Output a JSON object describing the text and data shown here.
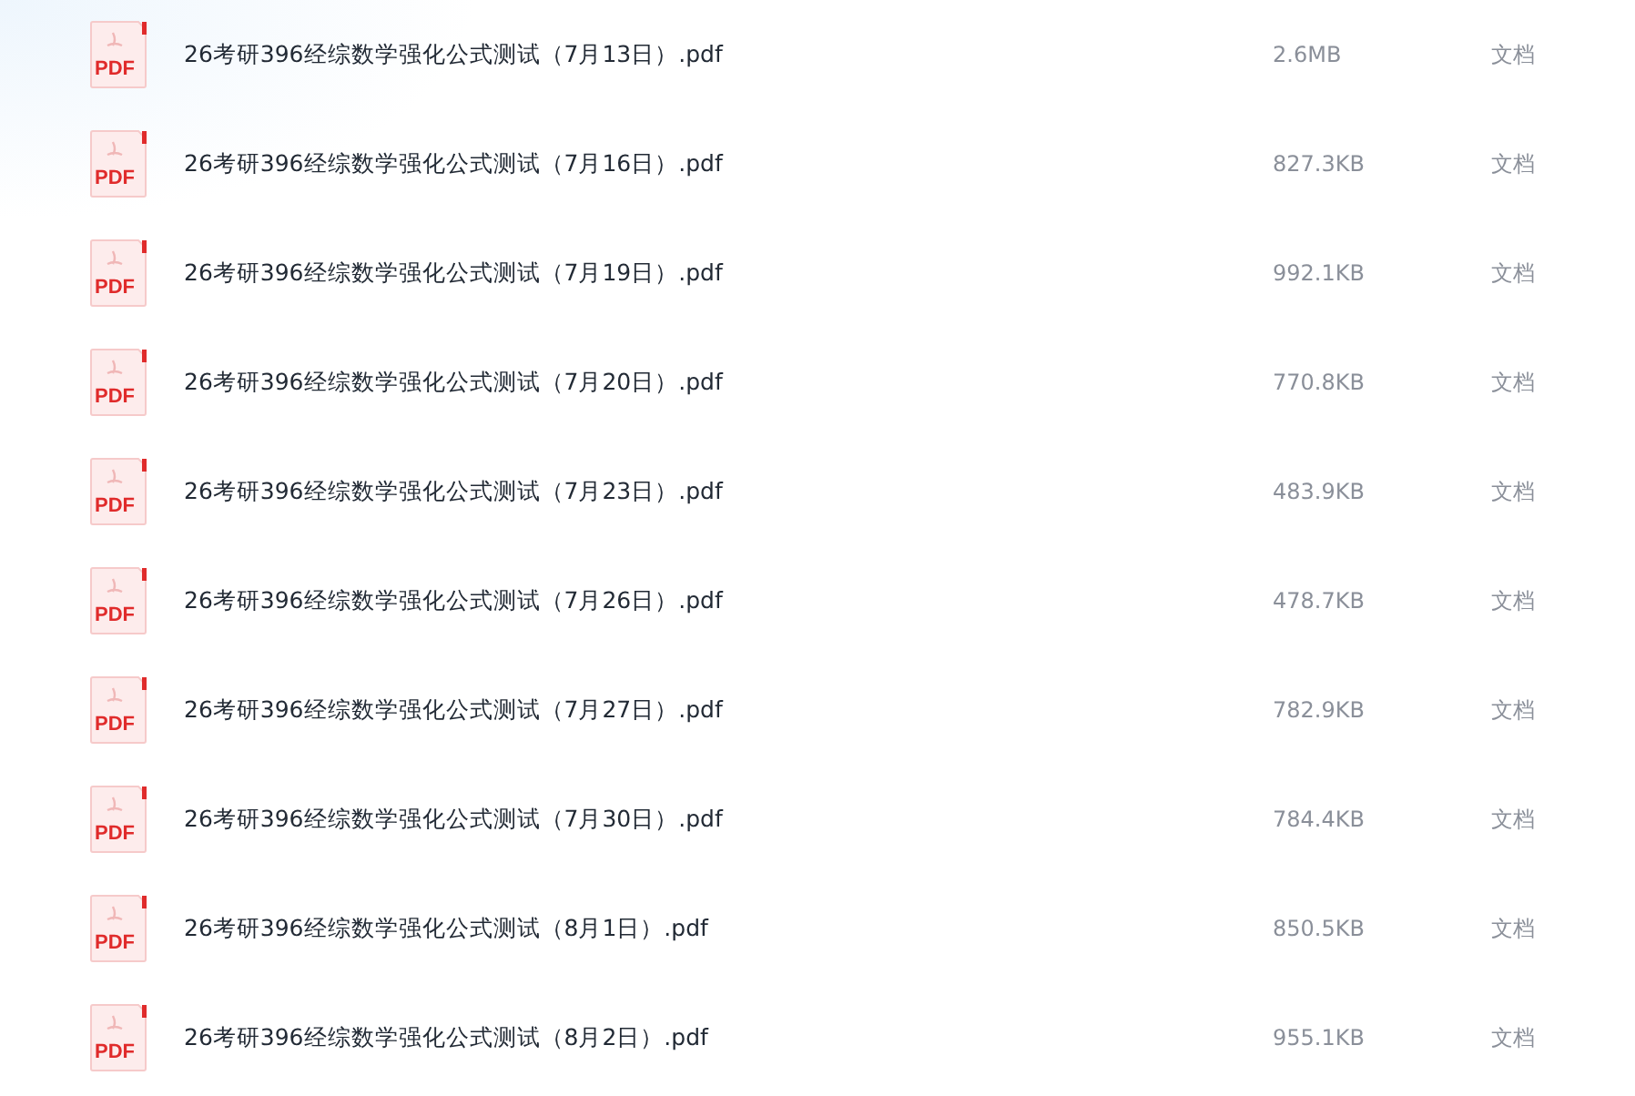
{
  "files": [
    {
      "icon_label": "PDF",
      "name": "26考研396经综数学强化公式测试（7月13日）.pdf",
      "size": "2.6MB",
      "type": "文档"
    },
    {
      "icon_label": "PDF",
      "name": "26考研396经综数学强化公式测试（7月16日）.pdf",
      "size": "827.3KB",
      "type": "文档"
    },
    {
      "icon_label": "PDF",
      "name": "26考研396经综数学强化公式测试（7月19日）.pdf",
      "size": "992.1KB",
      "type": "文档"
    },
    {
      "icon_label": "PDF",
      "name": "26考研396经综数学强化公式测试（7月20日）.pdf",
      "size": "770.8KB",
      "type": "文档"
    },
    {
      "icon_label": "PDF",
      "name": "26考研396经综数学强化公式测试（7月23日）.pdf",
      "size": "483.9KB",
      "type": "文档"
    },
    {
      "icon_label": "PDF",
      "name": "26考研396经综数学强化公式测试（7月26日）.pdf",
      "size": "478.7KB",
      "type": "文档"
    },
    {
      "icon_label": "PDF",
      "name": "26考研396经综数学强化公式测试（7月27日）.pdf",
      "size": "782.9KB",
      "type": "文档"
    },
    {
      "icon_label": "PDF",
      "name": "26考研396经综数学强化公式测试（7月30日）.pdf",
      "size": "784.4KB",
      "type": "文档"
    },
    {
      "icon_label": "PDF",
      "name": "26考研396经综数学强化公式测试（8月1日）.pdf",
      "size": "850.5KB",
      "type": "文档"
    },
    {
      "icon_label": "PDF",
      "name": "26考研396经综数学强化公式测试（8月2日）.pdf",
      "size": "955.1KB",
      "type": "文档"
    }
  ]
}
